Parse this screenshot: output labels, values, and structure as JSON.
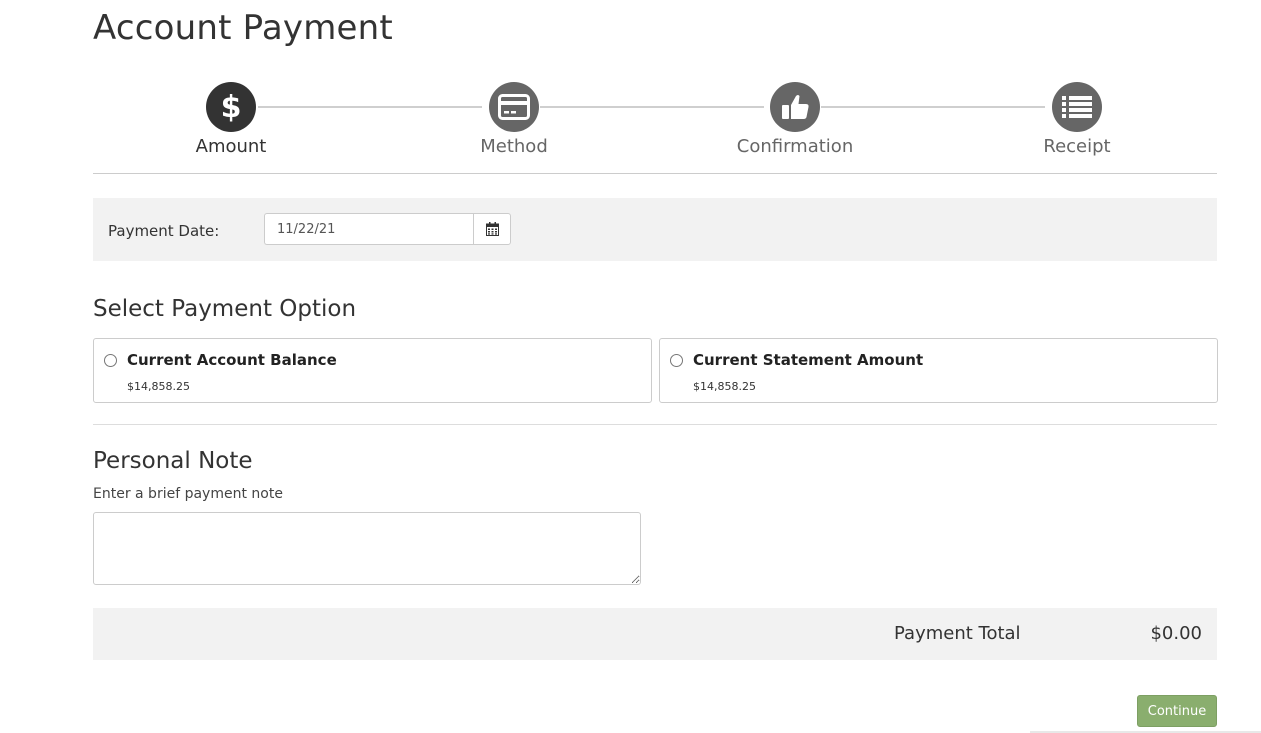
{
  "page": {
    "title": "Account Payment"
  },
  "stepper": {
    "steps": [
      {
        "label": "Amount",
        "icon": "dollar-icon",
        "active": true
      },
      {
        "label": "Method",
        "icon": "credit-card-icon",
        "active": false
      },
      {
        "label": "Confirmation",
        "icon": "thumbs-up-icon",
        "active": false
      },
      {
        "label": "Receipt",
        "icon": "list-icon",
        "active": false
      }
    ],
    "colors": {
      "active": "#333333",
      "inactive": "#666666"
    }
  },
  "payment_date": {
    "label": "Payment Date:",
    "value": "11/22/21",
    "icon": "calendar-icon"
  },
  "payment_option": {
    "title": "Select Payment Option",
    "options": [
      {
        "title": "Current Account Balance",
        "amount": "$14,858.25",
        "selected": false
      },
      {
        "title": "Current Statement Amount",
        "amount": "$14,858.25",
        "selected": false
      }
    ]
  },
  "personal_note": {
    "title": "Personal Note",
    "hint": "Enter a brief payment note",
    "value": ""
  },
  "total": {
    "label": "Payment Total",
    "value": "$0.00"
  },
  "actions": {
    "continue_label": "Continue",
    "continue_color": "#8aae6e"
  }
}
